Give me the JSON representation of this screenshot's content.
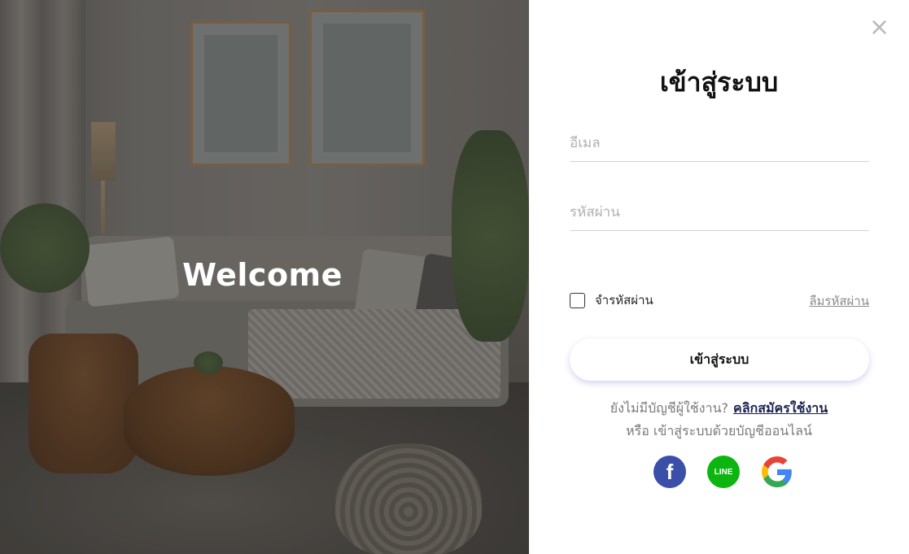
{
  "hero": {
    "welcome": "Welcome"
  },
  "panel": {
    "close_symbol": "×",
    "title": "เข้าสู่ระบบ",
    "email_placeholder": "อีเมล",
    "password_placeholder": "รหัสผ่าน",
    "remember_label": "จำรหัสผ่าน",
    "forgot_label": "ลืมรหัสผ่าน",
    "login_button": "เข้าสู่ระบบ",
    "no_account_text": "ยังไม่มีบัญชีผู้ใช้งาน?",
    "signup_link": "คลิกสมัครใช้งาน",
    "social_text": "หรือ เข้าสู่ระบบด้วยบัญชีออนไลน์",
    "social": [
      {
        "name": "facebook-icon",
        "glyph": "f"
      },
      {
        "name": "line-icon",
        "glyph": "LINE"
      },
      {
        "name": "google-icon",
        "glyph": "G"
      }
    ]
  },
  "colors": {
    "signup_link": "#1c2452",
    "facebook": "#3b4fa8",
    "line": "#0cb510",
    "close": "#b9b9b9"
  }
}
